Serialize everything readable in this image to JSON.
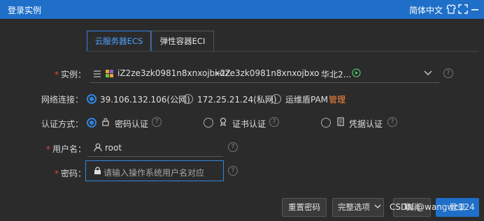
{
  "titlebar": {
    "title": "登录实例",
    "language": "简体中文"
  },
  "tabs": [
    {
      "label": "云服务器ECS"
    },
    {
      "label": "弹性容器ECI"
    }
  ],
  "instance": {
    "label": "实例：",
    "id": "iZ2ze3zk0981n8xnxojbxoZ",
    "name": "i-2ze3zk0981n8xnxojbxo",
    "region": "华北2..."
  },
  "network": {
    "label": "网络连接：",
    "options": [
      {
        "label": "39.106.132.106(公网)"
      },
      {
        "label": "172.25.21.24(私网)"
      },
      {
        "label": "运维盾PAM"
      }
    ],
    "manage_link": "管理"
  },
  "auth": {
    "label": "认证方式：",
    "options": [
      {
        "label": "密码认证"
      },
      {
        "label": "证书认证"
      },
      {
        "label": "凭据认证"
      }
    ]
  },
  "username": {
    "label": "用户名：",
    "value": "root"
  },
  "password": {
    "label": "密码：",
    "placeholder": "请输入操作系统用户名对应"
  },
  "footer": {
    "reset_password": "重置密码",
    "full_options": "完整选项",
    "cancel": "取消",
    "login": "登录"
  },
  "watermark": "CSDN @wangwc124",
  "colors": {
    "accent": "#1f6fc9",
    "link": "#ff8a3d",
    "required": "#e04848",
    "background": "#2b2b2b"
  }
}
